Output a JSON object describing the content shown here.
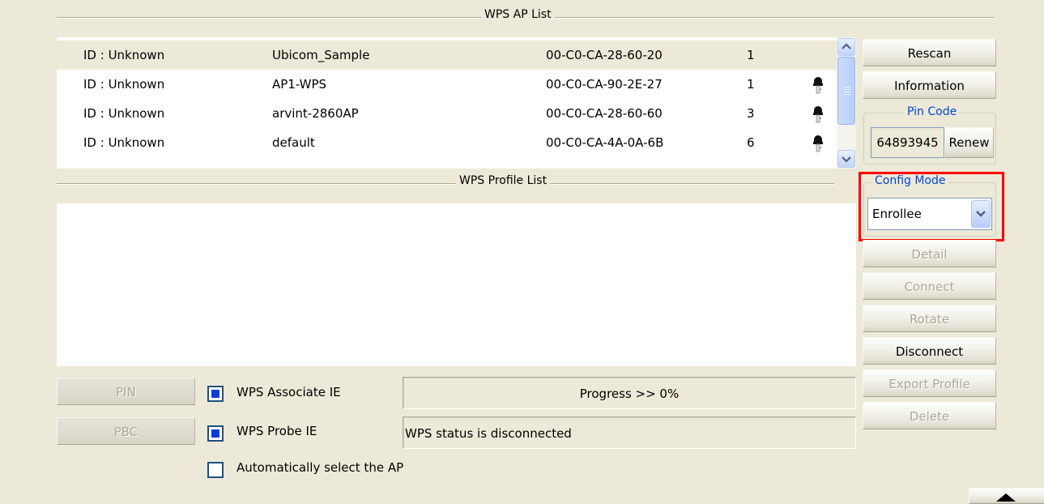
{
  "ap_list": {
    "title": "WPS AP List",
    "rows": [
      {
        "id": "ID : Unknown",
        "ssid": "Ubicom_Sample",
        "bssid": "00-C0-CA-28-60-20",
        "channel": "1",
        "encrypted": false,
        "selected": true
      },
      {
        "id": "ID : Unknown",
        "ssid": "AP1-WPS",
        "bssid": "00-C0-CA-90-2E-27",
        "channel": "1",
        "encrypted": true,
        "selected": false
      },
      {
        "id": "ID : Unknown",
        "ssid": "arvint-2860AP",
        "bssid": "00-C0-CA-28-60-60",
        "channel": "3",
        "encrypted": true,
        "selected": false
      },
      {
        "id": "ID : Unknown",
        "ssid": "default",
        "bssid": "00-C0-CA-4A-0A-6B",
        "channel": "6",
        "encrypted": true,
        "selected": false
      }
    ]
  },
  "profile_list": {
    "title": "WPS Profile List"
  },
  "right_panel": {
    "rescan": "Rescan",
    "information": "Information",
    "pin_code_title": "Pin Code",
    "pin_code_value": "64893945",
    "renew": "Renew",
    "config_mode_title": "Config Mode",
    "config_mode_value": "Enrollee",
    "detail": "Detail",
    "connect": "Connect",
    "rotate": "Rotate",
    "disconnect": "Disconnect",
    "export_profile": "Export Profile",
    "delete": "Delete"
  },
  "bottom": {
    "pin_button": "PIN",
    "pbc_button": "PBC",
    "wps_associate_ie": "WPS Associate IE",
    "wps_probe_ie": "WPS Probe IE",
    "auto_select_ap": "Automatically select the AP",
    "progress": "Progress >> 0%",
    "status": "WPS status is disconnected"
  },
  "colors": {
    "background": "#ece9d8",
    "highlight": "#ff0000",
    "group_title": "#0046d5"
  },
  "icons": {
    "encryption": "key-icon",
    "scroll_up": "arrow-up-icon",
    "scroll_down": "arrow-down-icon",
    "collapse": "triangle-up-icon"
  }
}
